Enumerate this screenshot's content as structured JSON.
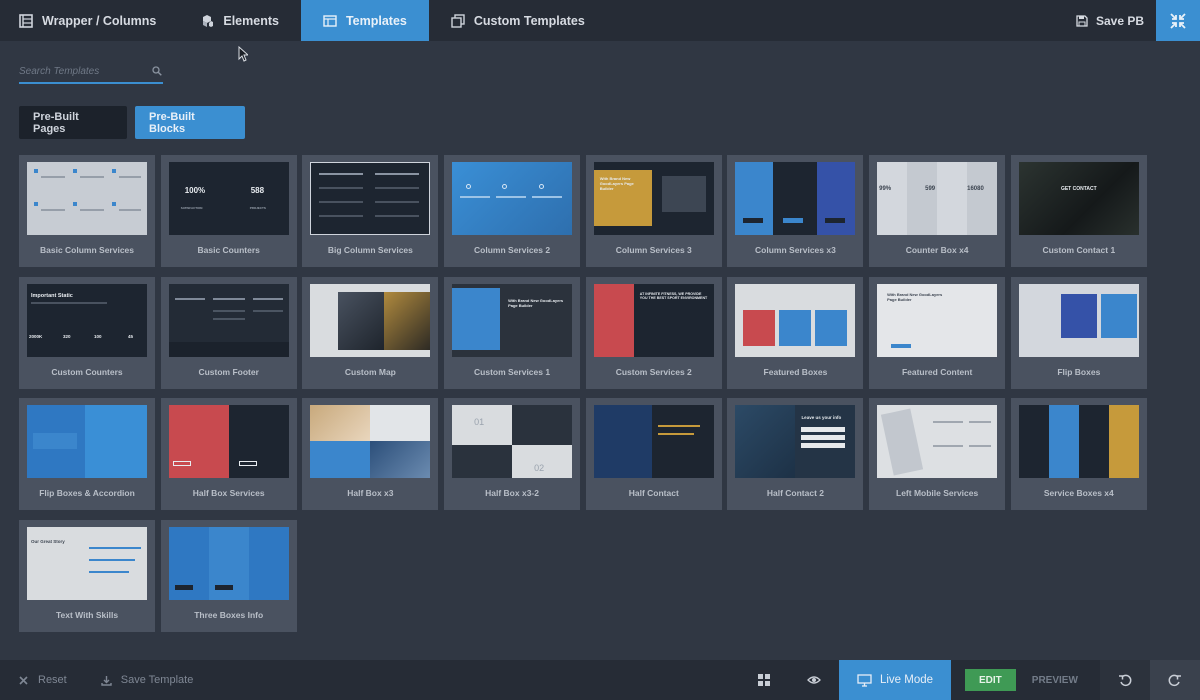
{
  "topbar": {
    "tabs": [
      {
        "label": "Wrapper / Columns",
        "icon": "columns-icon"
      },
      {
        "label": "Elements",
        "icon": "cubes-icon"
      },
      {
        "label": "Templates",
        "icon": "template-icon"
      },
      {
        "label": "Custom Templates",
        "icon": "copy-icon"
      }
    ],
    "active_tab": "Templates",
    "save_label": "Save PB"
  },
  "search": {
    "placeholder": "Search Templates"
  },
  "modes": {
    "prebuilt_pages": "Pre-Built Pages",
    "prebuilt_blocks": "Pre-Built Blocks",
    "active": "Pre-Built Blocks"
  },
  "templates": [
    {
      "label": "Basic Column Services"
    },
    {
      "label": "Basic Counters",
      "counters": [
        "100%",
        "588"
      ],
      "counter_captions": [
        "SATISFACTION",
        "PROJECTS"
      ]
    },
    {
      "label": "Big Column Services"
    },
    {
      "label": "Column Services 2"
    },
    {
      "label": "Column Services 3",
      "headline": "With Brand New GoodLayers Page Builder"
    },
    {
      "label": "Column Services x3"
    },
    {
      "label": "Counter Box x4",
      "counters": [
        "99%",
        "599",
        "16080"
      ]
    },
    {
      "label": "Custom Contact 1",
      "headline": "GET CONTACT"
    },
    {
      "label": "Custom Counters",
      "headline": "Important Static",
      "counters": [
        "2000K",
        "320",
        "100",
        "45"
      ]
    },
    {
      "label": "Custom Footer"
    },
    {
      "label": "Custom Map"
    },
    {
      "label": "Custom Services 1",
      "headline": "With Brand New GoodLayers Page Builder"
    },
    {
      "label": "Custom Services 2",
      "headline": "AT INFINITE FITNESS, WE PROVIDE YOU THE BEST SPORT ENVIRONMENT"
    },
    {
      "label": "Featured Boxes"
    },
    {
      "label": "Featured Content",
      "headline": "With Brand New GoodLayers Page Builder"
    },
    {
      "label": "Flip Boxes"
    },
    {
      "label": "Flip Boxes & Accordion"
    },
    {
      "label": "Half Box Services"
    },
    {
      "label": "Half Box x3"
    },
    {
      "label": "Half Box x3-2",
      "numbers": [
        "01",
        "02"
      ]
    },
    {
      "label": "Half Contact"
    },
    {
      "label": "Half Contact 2",
      "headline": "Leave us your info"
    },
    {
      "label": "Left Mobile Services"
    },
    {
      "label": "Service Boxes x4"
    },
    {
      "label": "Text With Skills",
      "headline": "Our Great Story"
    },
    {
      "label": "Three Boxes Info"
    }
  ],
  "bottombar": {
    "reset": "Reset",
    "save_template": "Save Template",
    "live_mode": "Live Mode",
    "edit": "EDIT",
    "preview": "PREVIEW"
  },
  "colors": {
    "accent": "#3b8fd1",
    "bar": "#262c36",
    "background": "#303743",
    "card": "#4a5260",
    "edit_green": "#3f9a55"
  }
}
